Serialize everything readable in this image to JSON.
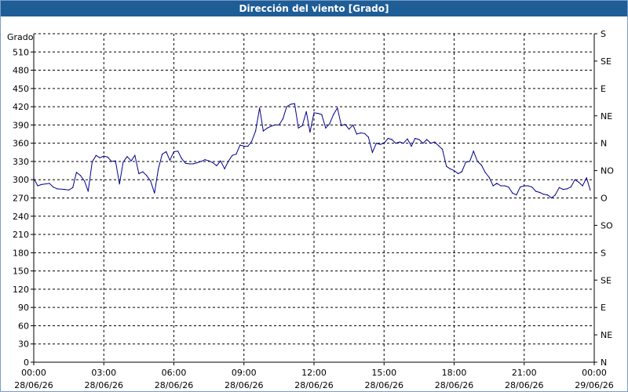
{
  "window": {
    "title": "Dirección del viento [Grado]"
  },
  "chart_data": {
    "type": "line",
    "title": "Dirección del viento [Grado]",
    "ylabel": "Grado",
    "ylim": [
      0,
      540
    ],
    "grid": true,
    "y_ticks": [
      0,
      30,
      60,
      90,
      120,
      150,
      180,
      210,
      240,
      270,
      300,
      330,
      360,
      390,
      420,
      450,
      480,
      510
    ],
    "y_tick_labels": [
      "0",
      "30",
      "60",
      "90",
      "120",
      "150",
      "180",
      "210",
      "240",
      "270",
      "300",
      "330",
      "360",
      "390",
      "420",
      "450",
      "480",
      "510"
    ],
    "right_axis_labels": [
      {
        "y": 540,
        "label": "S"
      },
      {
        "y": 495,
        "label": "SE"
      },
      {
        "y": 450,
        "label": "E"
      },
      {
        "y": 405,
        "label": "NE"
      },
      {
        "y": 360,
        "label": "N"
      },
      {
        "y": 315,
        "label": "NO"
      },
      {
        "y": 270,
        "label": "O"
      },
      {
        "y": 225,
        "label": "SO"
      },
      {
        "y": 180,
        "label": "S"
      },
      {
        "y": 135,
        "label": "SE"
      },
      {
        "y": 90,
        "label": "E"
      },
      {
        "y": 45,
        "label": "NE"
      },
      {
        "y": 0,
        "label": "N"
      }
    ],
    "xlim_hours": [
      0,
      24
    ],
    "x_ticks": [
      {
        "hour": 0,
        "time": "00:00",
        "date": "28/06/26"
      },
      {
        "hour": 3,
        "time": "03:00",
        "date": "28/06/26"
      },
      {
        "hour": 6,
        "time": "06:00",
        "date": "28/06/26"
      },
      {
        "hour": 9,
        "time": "09:00",
        "date": "28/06/26"
      },
      {
        "hour": 12,
        "time": "12:00",
        "date": "28/06/26"
      },
      {
        "hour": 15,
        "time": "15:00",
        "date": "28/06/26"
      },
      {
        "hour": 18,
        "time": "18:00",
        "date": "28/06/26"
      },
      {
        "hour": 21,
        "time": "21:00",
        "date": "28/06/26"
      },
      {
        "hour": 24,
        "time": "00:00",
        "date": "29/06/26"
      }
    ],
    "series": [
      {
        "color": "#00008b",
        "points": [
          [
            0.0,
            302
          ],
          [
            0.17,
            290
          ],
          [
            0.33,
            292
          ],
          [
            0.67,
            294
          ],
          [
            0.83,
            288
          ],
          [
            1.0,
            285
          ],
          [
            1.33,
            284
          ],
          [
            1.5,
            283
          ],
          [
            1.67,
            287
          ],
          [
            1.83,
            312
          ],
          [
            2.0,
            307
          ],
          [
            2.17,
            298
          ],
          [
            2.33,
            281
          ],
          [
            2.5,
            329
          ],
          [
            2.67,
            340
          ],
          [
            2.83,
            336
          ],
          [
            3.0,
            339
          ],
          [
            3.17,
            337
          ],
          [
            3.33,
            330
          ],
          [
            3.5,
            331
          ],
          [
            3.67,
            293
          ],
          [
            3.83,
            329
          ],
          [
            4.0,
            338
          ],
          [
            4.17,
            331
          ],
          [
            4.33,
            340
          ],
          [
            4.5,
            310
          ],
          [
            4.67,
            313
          ],
          [
            4.83,
            307
          ],
          [
            5.0,
            298
          ],
          [
            5.17,
            278
          ],
          [
            5.33,
            317
          ],
          [
            5.5,
            342
          ],
          [
            5.67,
            346
          ],
          [
            5.83,
            332
          ],
          [
            6.0,
            346
          ],
          [
            6.17,
            347
          ],
          [
            6.33,
            335
          ],
          [
            6.5,
            327
          ],
          [
            6.67,
            326
          ],
          [
            6.83,
            326
          ],
          [
            7.0,
            328
          ],
          [
            7.17,
            330
          ],
          [
            7.33,
            333
          ],
          [
            7.5,
            331
          ],
          [
            7.67,
            328
          ],
          [
            7.83,
            323
          ],
          [
            8.0,
            331
          ],
          [
            8.17,
            318
          ],
          [
            8.33,
            330
          ],
          [
            8.5,
            340
          ],
          [
            8.67,
            342
          ],
          [
            8.83,
            357
          ],
          [
            9.0,
            355
          ],
          [
            9.17,
            355
          ],
          [
            9.33,
            363
          ],
          [
            9.5,
            380
          ],
          [
            9.67,
            418
          ],
          [
            9.83,
            380
          ],
          [
            10.0,
            385
          ],
          [
            10.17,
            388
          ],
          [
            10.33,
            390
          ],
          [
            10.5,
            390
          ],
          [
            10.67,
            400
          ],
          [
            10.83,
            420
          ],
          [
            11.0,
            424
          ],
          [
            11.17,
            425
          ],
          [
            11.33,
            385
          ],
          [
            11.5,
            389
          ],
          [
            11.67,
            412
          ],
          [
            11.83,
            378
          ],
          [
            12.0,
            410
          ],
          [
            12.17,
            409
          ],
          [
            12.33,
            407
          ],
          [
            12.5,
            385
          ],
          [
            12.67,
            392
          ],
          [
            12.83,
            407
          ],
          [
            13.0,
            418
          ],
          [
            13.17,
            389
          ],
          [
            13.33,
            391
          ],
          [
            13.5,
            383
          ],
          [
            13.67,
            390
          ],
          [
            13.83,
            375
          ],
          [
            14.0,
            377
          ],
          [
            14.17,
            376
          ],
          [
            14.33,
            370
          ],
          [
            14.5,
            345
          ],
          [
            14.67,
            360
          ],
          [
            14.83,
            358
          ],
          [
            15.0,
            360
          ],
          [
            15.17,
            368
          ],
          [
            15.33,
            366
          ],
          [
            15.5,
            360
          ],
          [
            15.67,
            362
          ],
          [
            15.83,
            360
          ],
          [
            16.0,
            367
          ],
          [
            16.17,
            355
          ],
          [
            16.33,
            368
          ],
          [
            16.5,
            366
          ],
          [
            16.67,
            360
          ],
          [
            16.83,
            366
          ],
          [
            17.0,
            360
          ],
          [
            17.17,
            362
          ],
          [
            17.33,
            356
          ],
          [
            17.5,
            350
          ],
          [
            17.67,
            322
          ],
          [
            17.83,
            318
          ],
          [
            18.0,
            315
          ],
          [
            18.17,
            310
          ],
          [
            18.33,
            313
          ],
          [
            18.5,
            329
          ],
          [
            18.67,
            330
          ],
          [
            18.83,
            347
          ],
          [
            19.0,
            330
          ],
          [
            19.17,
            324
          ],
          [
            19.33,
            312
          ],
          [
            19.5,
            304
          ],
          [
            19.67,
            290
          ],
          [
            19.83,
            294
          ],
          [
            20.0,
            290
          ],
          [
            20.17,
            290
          ],
          [
            20.33,
            288
          ],
          [
            20.5,
            278
          ],
          [
            20.67,
            275
          ],
          [
            20.83,
            288
          ],
          [
            21.0,
            290
          ],
          [
            21.17,
            290
          ],
          [
            21.33,
            288
          ],
          [
            21.5,
            281
          ],
          [
            21.67,
            279
          ],
          [
            21.83,
            276
          ],
          [
            22.0,
            275
          ],
          [
            22.17,
            270
          ],
          [
            22.33,
            275
          ],
          [
            22.5,
            287
          ],
          [
            22.67,
            284
          ],
          [
            22.83,
            285
          ],
          [
            23.0,
            288
          ],
          [
            23.17,
            300
          ],
          [
            23.33,
            296
          ],
          [
            23.5,
            290
          ],
          [
            23.67,
            303
          ],
          [
            23.83,
            283
          ]
        ]
      }
    ]
  }
}
